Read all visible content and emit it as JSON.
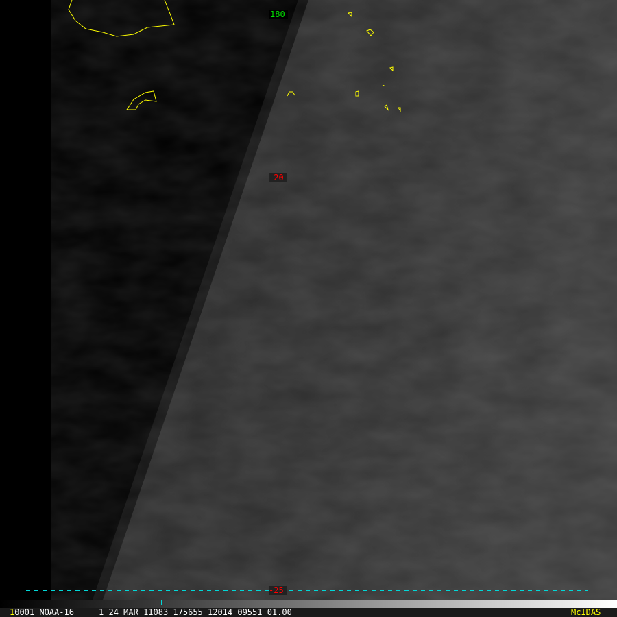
{
  "grid_labels": {
    "longitude": "180",
    "lat_upper": "-20",
    "lat_lower": "-25"
  },
  "info_bar": {
    "frame_number": "1",
    "text": "0001 NOAA-16     1 24 MAR 11083 175655 12014 09551 01.00",
    "brand": "McIDAS"
  },
  "colors": {
    "coastline": "#ffff00",
    "grid": "#00d8d8",
    "lon_label": "#00e000",
    "lat_label": "#ff0000",
    "brand": "#ffff00"
  }
}
